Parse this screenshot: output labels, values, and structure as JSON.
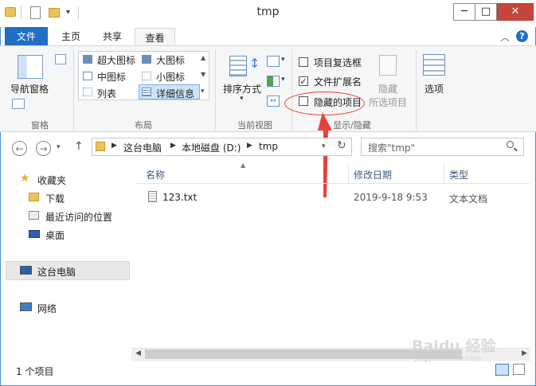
{
  "window": {
    "title": "tmp"
  },
  "window_controls": {
    "minimize": "─",
    "maximize": "□",
    "close": "✕"
  },
  "tabs": [
    "文件",
    "主页",
    "共享",
    "查看"
  ],
  "ribbon": {
    "pane": {
      "nav_pane": "导航窗格",
      "group": "窗格"
    },
    "layout": {
      "items": [
        "超大图标",
        "大图标",
        "中图标",
        "小图标",
        "列表",
        "详细信息"
      ],
      "group": "布局"
    },
    "current_view": {
      "sort": "排序方式",
      "group": "当前视图"
    },
    "show_hide": {
      "item_checkboxes": "项目复选框",
      "file_extensions": "文件扩展名",
      "hidden_items": "隐藏的项目",
      "hide_selected_line1": "隐藏",
      "hide_selected_line2": "所选项目",
      "options": "选项",
      "group": "显示/隐藏"
    }
  },
  "address_bar": {
    "segments": [
      "这台电脑",
      "本地磁盘 (D:)",
      "tmp"
    ],
    "search_placeholder": "搜索\"tmp\""
  },
  "nav_pane": {
    "favorites": "收藏夹",
    "downloads": "下载",
    "recent": "最近访问的位置",
    "desktop": "桌面",
    "this_pc": "这台电脑",
    "network": "网络"
  },
  "file_list": {
    "columns": [
      "名称",
      "修改日期",
      "类型"
    ],
    "rows": [
      {
        "name": "123.txt",
        "modified": "2019-9-18 9:53",
        "type": "文本文档"
      }
    ]
  },
  "status_bar": {
    "count": "1 个项目"
  },
  "watermark": {
    "text": "Baidu 经验",
    "sub": "jingyan.baidu.com"
  },
  "colors": {
    "accent": "#1e6fc5",
    "annotation": "#e8413a",
    "close": "#c7463c"
  }
}
